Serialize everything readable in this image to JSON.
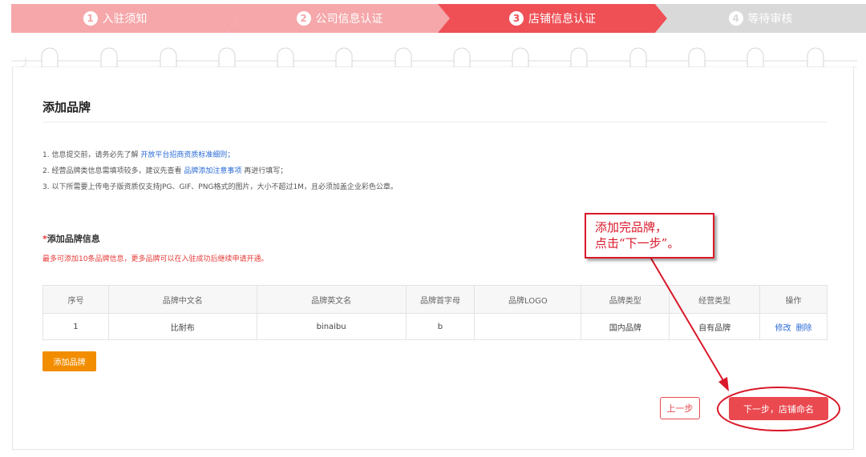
{
  "steps": [
    {
      "num": "1",
      "label": "入驻须知"
    },
    {
      "num": "2",
      "label": "公司信息认证"
    },
    {
      "num": "3",
      "label": "店铺信息认证"
    },
    {
      "num": "4",
      "label": "等待审核"
    }
  ],
  "page_title": "添加品牌",
  "notes": {
    "n1_text": "1. 信息提交前，请务必先了解 ",
    "n1_link": "开放平台招商资质标准细则；",
    "n2_text": "2. 经营品牌类信息需填项较多，建议先查看 ",
    "n2_link": "品牌添加注意事项",
    "n2_suffix": " 再进行填写；",
    "n3_text": "3. 以下所需要上传电子版资质仅支持JPG、GIF、PNG格式的图片，大小不超过1M，且必须加盖企业彩色公章。"
  },
  "brand_section": {
    "star": "*",
    "title": "添加品牌信息",
    "subtitle": "最多可添加10条品牌信息，更多品牌可以在入驻成功后继续申请开通。"
  },
  "table": {
    "headers": [
      "序号",
      "品牌中文名",
      "品牌英文名",
      "品牌首字母",
      "品牌LOGO",
      "品牌类型",
      "经营类型",
      "操作"
    ],
    "rows": [
      {
        "index": "1",
        "cn_name": "比耐布",
        "en_name": "binaibu",
        "initial": "b",
        "logo": "",
        "brand_type": "国内品牌",
        "biz_type": "自有品牌",
        "edit": "修改",
        "delete": "删除"
      }
    ]
  },
  "buttons": {
    "add_brand": "添加品牌",
    "prev": "上一步",
    "next": "下一步，店铺命名"
  },
  "annotation": {
    "line1": "添加完品牌，",
    "line2": "点击“下一步”。"
  },
  "colors": {
    "step_done": "#f5a7aa",
    "step_active": "#ef5056",
    "step_pending": "#d9d9d9",
    "link": "#2a6ad7",
    "warning": "#e53935",
    "add_button": "#f28d00",
    "primary": "#e9494f",
    "annotation": "#d9182a"
  }
}
